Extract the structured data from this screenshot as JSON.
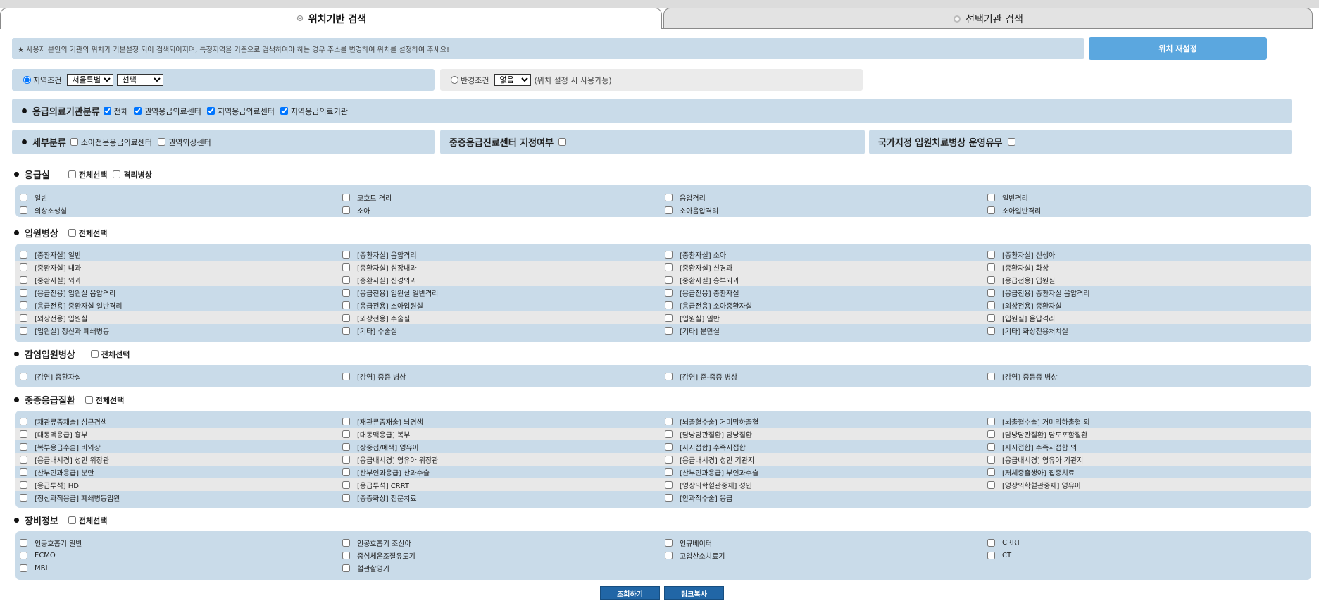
{
  "tabs": [
    {
      "label": "위치기반 검색",
      "active": true
    },
    {
      "label": "선택기관 검색",
      "active": false
    }
  ],
  "notice": "★ 사용자 본인의 기관의 위치가 기본설정 되어 검색되어지며, 특정지역을 기준으로 검색하여야 하는 경우 주소를 변경하여 위치를 설정하여 주세요!",
  "reset_button": "위치 재설정",
  "region": {
    "label": "지역조건",
    "sido_selected": "서울특별시",
    "sigungu_selected": "선택"
  },
  "radius": {
    "label": "반경조건",
    "selected": "없음",
    "hint": "(위치 설정 시 사용가능)"
  },
  "classification": {
    "title": "응급의료기관분류",
    "options": [
      "전체",
      "권역응급의료센터",
      "지역응급의료센터",
      "지역응급의료기관"
    ]
  },
  "subclass": {
    "title": "세부분류",
    "options": [
      "소아전문응급의료센터",
      "권역외상센터"
    ]
  },
  "severe_center": {
    "label": "중증응급진료센터 지정여부"
  },
  "national_bed": {
    "label": "국가지정 입원치료병상 운영유무"
  },
  "er": {
    "title": "응급실",
    "select_all": "전체선택",
    "extra": "격리병상",
    "rows": [
      [
        "일반",
        "코호트 격리",
        "음압격리",
        "일반격리"
      ],
      [
        "외상소생실",
        "소아",
        "소아음압격리",
        "소아일반격리"
      ]
    ]
  },
  "inpatient": {
    "title": "입원병상",
    "select_all": "전체선택",
    "rows": [
      [
        "[중환자실] 일반",
        "[중환자실] 음압격리",
        "[중환자실] 소아",
        "[중환자실] 신생아"
      ],
      [
        "[중환자실] 내과",
        "[중환자실] 심장내과",
        "[중환자실] 신경과",
        "[중환자실] 화상"
      ],
      [
        "[중환자실] 외과",
        "[중환자실] 신경외과",
        "[중환자실] 흉부외과",
        "[응급전용] 입원실"
      ],
      [
        "[응급전용] 입원실 음압격리",
        "[응급전용] 입원실 일반격리",
        "[응급전용] 중환자실",
        "[응급전용] 중환자실 음압격리"
      ],
      [
        "[응급전용] 중환자실 일반격리",
        "[응급전용] 소아입원실",
        "[응급전용] 소아중환자실",
        "[외상전용] 중환자실"
      ],
      [
        "[외상전용] 입원실",
        "[외상전용] 수술실",
        "[입원실] 일반",
        "[입원실] 음압격리"
      ],
      [
        "[입원실] 정신과 폐쇄병동",
        "[기타] 수술실",
        "[기타] 분만실",
        "[기타] 화상전용처치실"
      ]
    ]
  },
  "infection": {
    "title": "감염입원병상",
    "select_all": "전체선택",
    "rows": [
      [
        "[감염] 중환자실",
        "[감염] 중증 병상",
        "[감염] 준-중증 병상",
        "[감염] 중등증 병상"
      ]
    ]
  },
  "severe": {
    "title": "중증응급질환",
    "select_all": "전체선택",
    "rows": [
      [
        "[재관류중재술] 심근경색",
        "[재관류중재술] 뇌경색",
        "[뇌출혈수술] 거미막하출혈",
        "[뇌출혈수술] 거미막하출혈 외"
      ],
      [
        "[대동맥응급] 흉부",
        "[대동맥응급] 복부",
        "[담낭담관질환] 담낭질환",
        "[담낭담관질환] 담도포함질환"
      ],
      [
        "[복부응급수술] 비외상",
        "[장중첩/폐색] 영유아",
        "[사지접합] 수족지접합",
        "[사지접합] 수족지접합 외"
      ],
      [
        "[응급내시경] 성인 위장관",
        "[응급내시경] 영유아 위장관",
        "[응급내시경] 성인 기관지",
        "[응급내시경] 영유아 기관지"
      ],
      [
        "[산부인과응급] 분만",
        "[산부인과응급] 산과수술",
        "[산부인과응급] 부인과수술",
        "[저체중출생아] 집중치료"
      ],
      [
        "[응급투석] HD",
        "[응급투석] CRRT",
        "[영상의학혈관중재] 성인",
        "[영상의학혈관중재] 영유아"
      ],
      [
        "[정신과적응급] 폐쇄병동입원",
        "[중증화상] 전문치료",
        "[안과적수술] 응급",
        ""
      ]
    ]
  },
  "equipment": {
    "title": "장비정보",
    "select_all": "전체선택",
    "rows": [
      [
        "인공호흡기 일반",
        "인공호흡기 조산아",
        "인큐베이터",
        "CRRT"
      ],
      [
        "ECMO",
        "중심체온조절유도기",
        "고압산소치료기",
        "CT"
      ],
      [
        "MRI",
        "혈관촬영기",
        "",
        ""
      ]
    ]
  },
  "buttons": {
    "search": "조회하기",
    "copy_link": "링크복사"
  }
}
